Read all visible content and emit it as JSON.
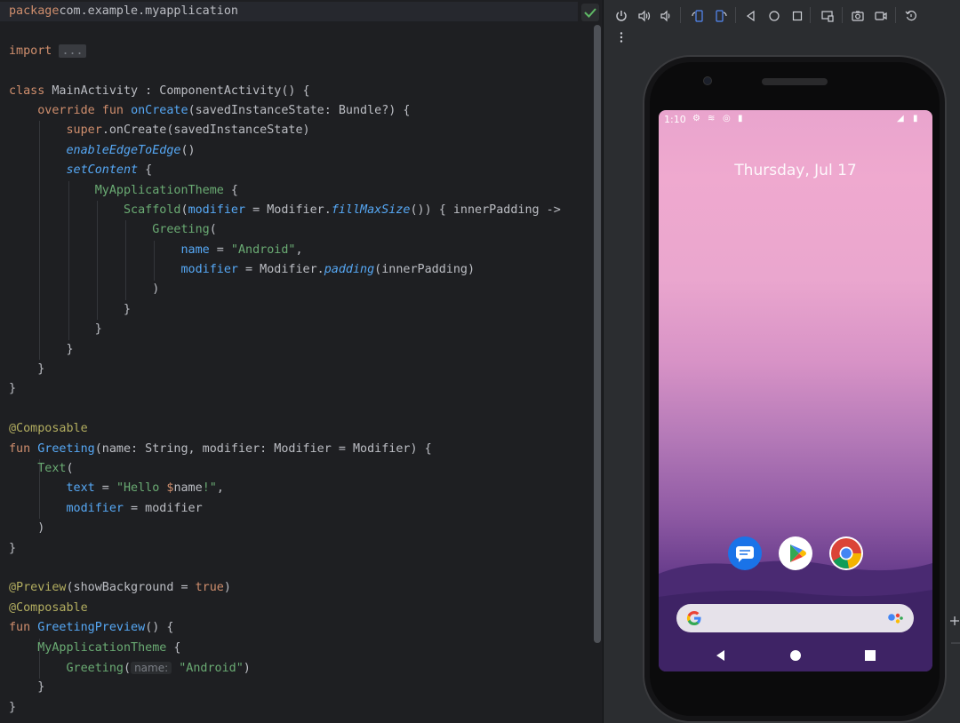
{
  "editor": {
    "status": "check-icon",
    "lines": [
      [
        [
          "kw",
          "package"
        ],
        [
          "",
          "com.example.myapplication"
        ]
      ],
      [],
      [
        [
          "kw",
          "import"
        ],
        [
          "",
          " "
        ],
        [
          "fold",
          "..."
        ]
      ],
      [],
      [
        [
          "kw",
          "class"
        ],
        [
          "",
          " MainActivity : ComponentActivity() {"
        ]
      ],
      [
        [
          "",
          "    "
        ],
        [
          "kw",
          "override fun"
        ],
        [
          "",
          " "
        ],
        [
          "fn",
          "onCreate"
        ],
        [
          "",
          "(savedInstanceState: Bundle?) {"
        ]
      ],
      [
        [
          "",
          "        "
        ],
        [
          "kw",
          "super"
        ],
        [
          "",
          ".onCreate(savedInstanceState)"
        ]
      ],
      [
        [
          "",
          "        "
        ],
        [
          "it",
          "enableEdgeToEdge"
        ],
        [
          "",
          "()"
        ]
      ],
      [
        [
          "",
          "        "
        ],
        [
          "it",
          "setContent"
        ],
        [
          "",
          " {"
        ]
      ],
      [
        [
          "",
          "            "
        ],
        [
          "comp",
          "MyApplicationTheme"
        ],
        [
          "",
          " {"
        ]
      ],
      [
        [
          "",
          "                "
        ],
        [
          "comp",
          "Scaffold"
        ],
        [
          "",
          "("
        ],
        [
          "named",
          "modifier"
        ],
        [
          "",
          " = Modifier."
        ],
        [
          "it",
          "fillMaxSize"
        ],
        [
          "",
          "()) { innerPadding ->"
        ]
      ],
      [
        [
          "",
          "                    "
        ],
        [
          "comp",
          "Greeting"
        ],
        [
          "",
          "("
        ]
      ],
      [
        [
          "",
          "                        "
        ],
        [
          "named",
          "name"
        ],
        [
          "",
          " = "
        ],
        [
          "str",
          "\"Android\""
        ],
        [
          "",
          ","
        ]
      ],
      [
        [
          "",
          "                        "
        ],
        [
          "named",
          "modifier"
        ],
        [
          "",
          " = Modifier."
        ],
        [
          "it",
          "padding"
        ],
        [
          "",
          "(innerPadding)"
        ]
      ],
      [
        [
          "",
          "                    )"
        ]
      ],
      [
        [
          "",
          "                }"
        ]
      ],
      [
        [
          "",
          "            }"
        ]
      ],
      [
        [
          "",
          "        }"
        ]
      ],
      [
        [
          "",
          "    }"
        ]
      ],
      [
        [
          "",
          "}"
        ]
      ],
      [],
      [
        [
          "ann",
          "@Composable"
        ]
      ],
      [
        [
          "kw",
          "fun"
        ],
        [
          "",
          " "
        ],
        [
          "fn",
          "Greeting"
        ],
        [
          "",
          "(name: String, modifier: Modifier = Modifier) {"
        ]
      ],
      [
        [
          "",
          "    "
        ],
        [
          "comp",
          "Text"
        ],
        [
          "",
          "("
        ]
      ],
      [
        [
          "",
          "        "
        ],
        [
          "named",
          "text"
        ],
        [
          "",
          " = "
        ],
        [
          "str",
          "\"Hello "
        ],
        [
          "kw",
          "$"
        ],
        [
          "",
          "name"
        ],
        [
          "str",
          "!\""
        ],
        [
          "",
          ","
        ]
      ],
      [
        [
          "",
          "        "
        ],
        [
          "named",
          "modifier"
        ],
        [
          "",
          " = modifier"
        ]
      ],
      [
        [
          "",
          "    )"
        ]
      ],
      [
        [
          "",
          "}"
        ]
      ],
      [],
      [
        [
          "ann",
          "@Preview"
        ],
        [
          "",
          "(showBackground = "
        ],
        [
          "kw",
          "true"
        ],
        [
          "",
          ")"
        ]
      ],
      [
        [
          "ann",
          "@Composable"
        ]
      ],
      [
        [
          "kw",
          "fun"
        ],
        [
          "",
          " "
        ],
        [
          "fn",
          "GreetingPreview"
        ],
        [
          "",
          "() {"
        ]
      ],
      [
        [
          "",
          "    "
        ],
        [
          "comp",
          "MyApplicationTheme"
        ],
        [
          "",
          " {"
        ]
      ],
      [
        [
          "",
          "        "
        ],
        [
          "comp",
          "Greeting"
        ],
        [
          "",
          "("
        ],
        [
          "hint",
          "name:"
        ],
        [
          "",
          " "
        ],
        [
          "str",
          "\"Android\""
        ],
        [
          "",
          ")"
        ]
      ],
      [
        [
          "",
          "    }"
        ]
      ],
      [
        [
          "",
          "}"
        ]
      ]
    ]
  },
  "emulator": {
    "toolbar_icons": [
      "power-icon",
      "volume-up-icon",
      "volume-down-icon",
      "rotate-left-icon",
      "rotate-right-icon",
      "back-icon",
      "home-icon",
      "overview-icon",
      "fold-icon",
      "screenshot-icon",
      "screen-record-icon",
      "reset-icon",
      "more-icon"
    ],
    "status_time": "1:10",
    "date": "Thursday, Jul 17",
    "apps": [
      "messages-icon",
      "play-store-icon",
      "chrome-icon"
    ],
    "colors": {
      "wallpaper_top": "#efa9cf",
      "wallpaper_bottom": "#2f1e52",
      "search_bar": "#e6e2ea"
    }
  }
}
